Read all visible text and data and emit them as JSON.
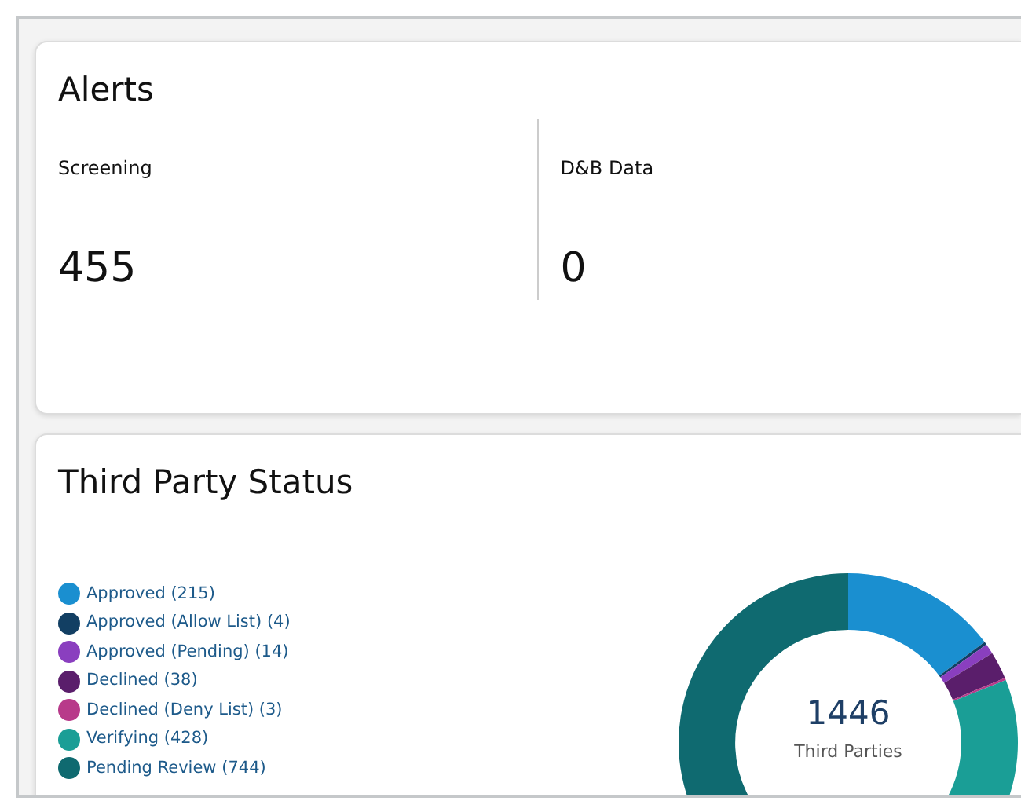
{
  "alerts": {
    "title": "Alerts",
    "metrics": [
      {
        "label": "Screening",
        "value": "455"
      },
      {
        "label": "D&B Data",
        "value": "0"
      }
    ]
  },
  "third_party_status": {
    "title": "Third Party Status",
    "legend": [
      {
        "label": "Approved (215)",
        "color": "#1a8fd0"
      },
      {
        "label": "Approved (Allow List) (4)",
        "color": "#123f63"
      },
      {
        "label": "Approved (Pending) (14)",
        "color": "#8a3fbf"
      },
      {
        "label": "Declined (38)",
        "color": "#5a1e6b"
      },
      {
        "label": "Declined (Deny List) (3)",
        "color": "#b83a8a"
      },
      {
        "label": "Verifying (428)",
        "color": "#1a9e96"
      },
      {
        "label": "Pending Review (744)",
        "color": "#0f6a70"
      }
    ],
    "center_value": "1446",
    "center_label": "Third Parties",
    "chart_data": {
      "type": "donut",
      "values": [
        14.87,
        0.28,
        0.97,
        2.63,
        0.21,
        29.6,
        51.44
      ]
    }
  }
}
